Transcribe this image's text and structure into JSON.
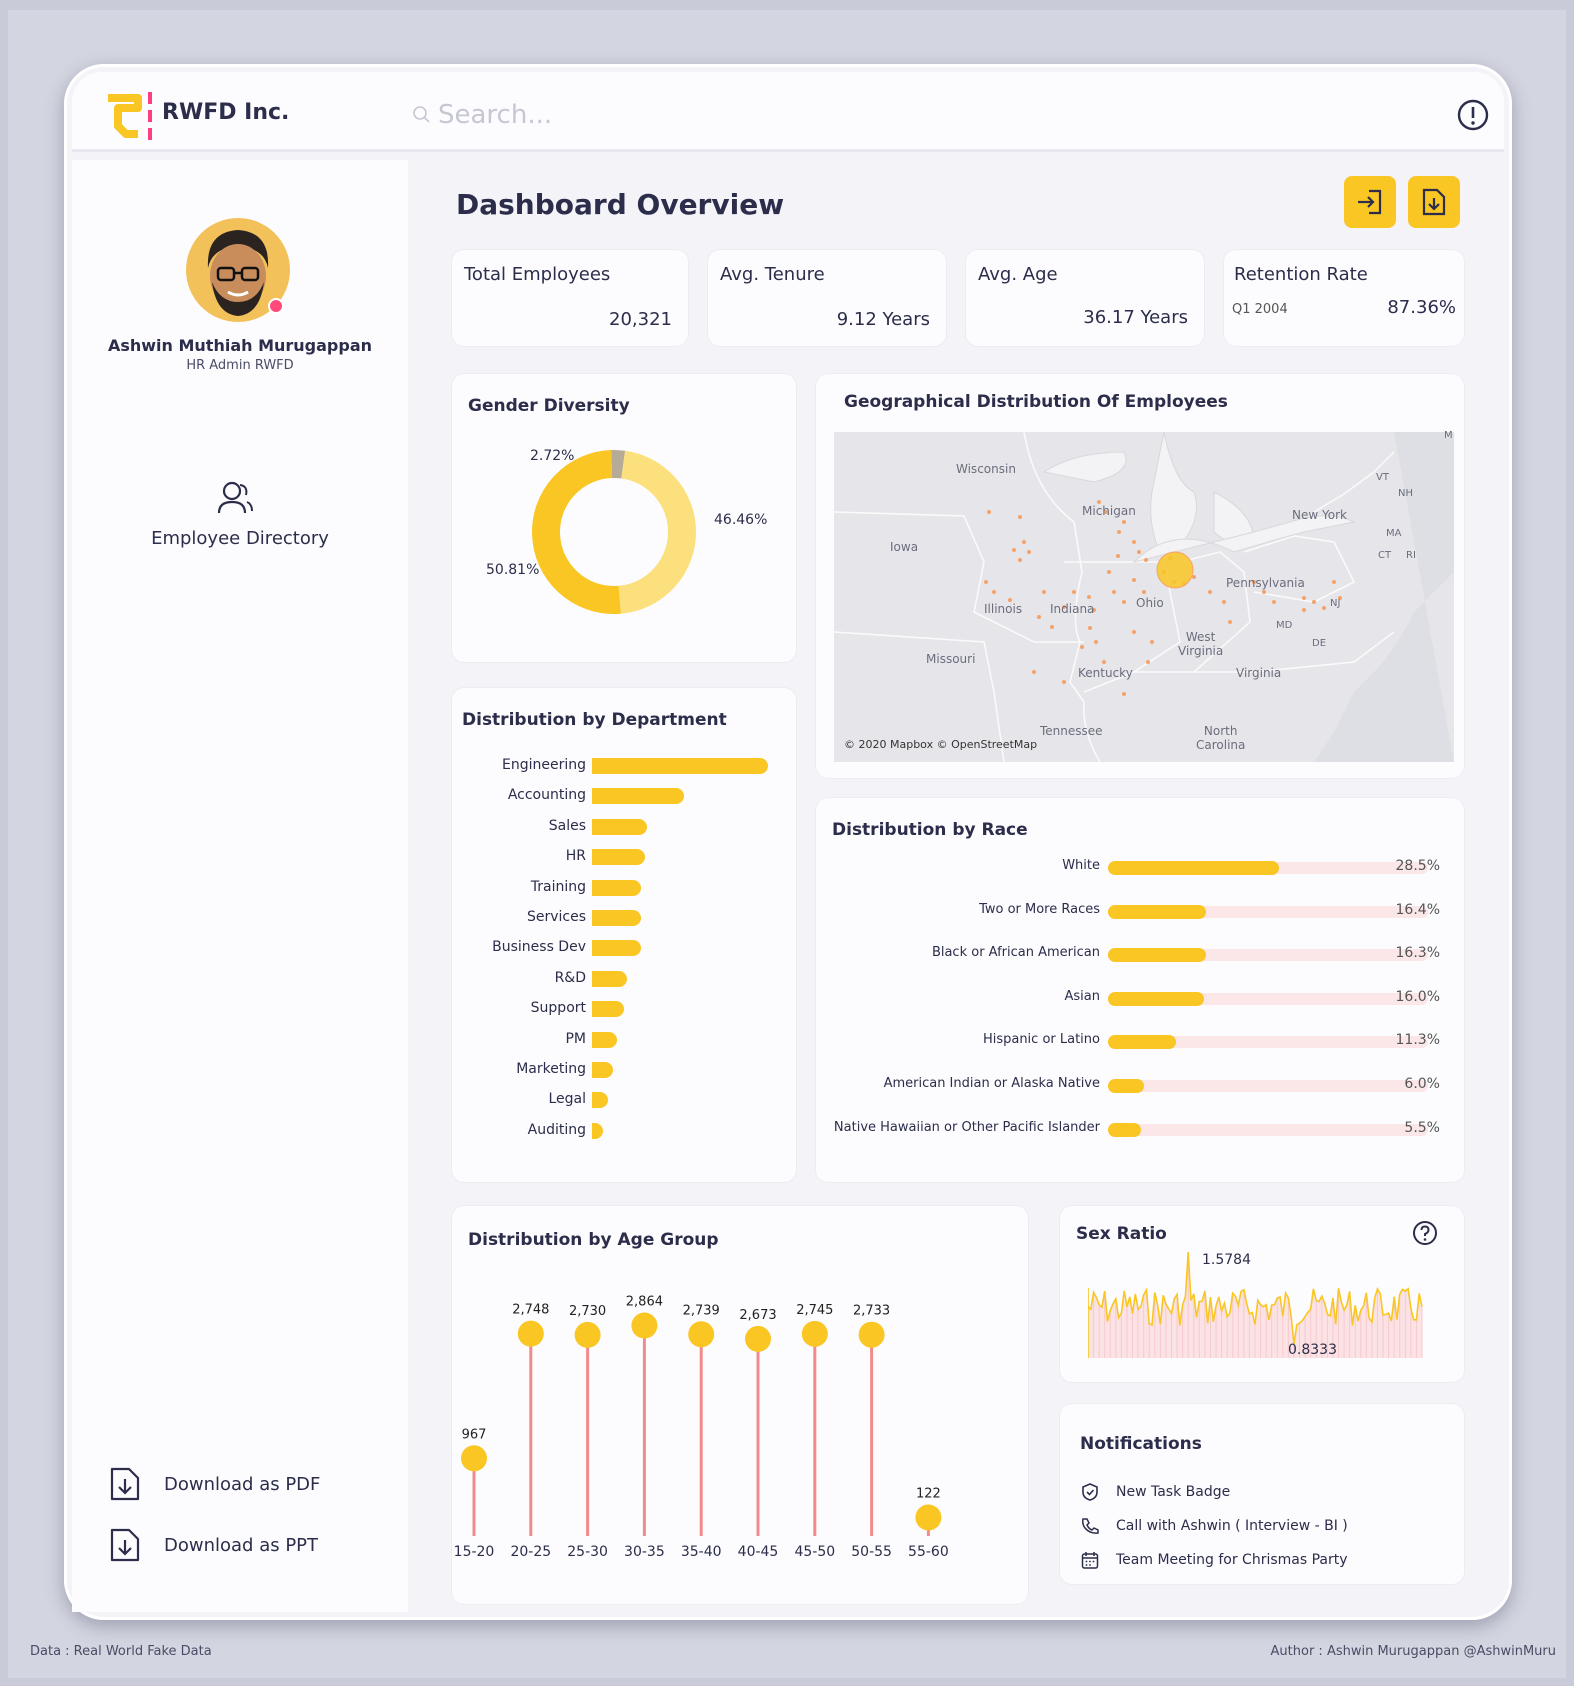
{
  "app": {
    "name": "RWFD Inc.",
    "search_placeholder": "Search..."
  },
  "user": {
    "name": "Ashwin Muthiah Murugappan",
    "role": "HR Admin RWFD"
  },
  "nav": {
    "directory": "Employee Directory",
    "download_pdf": "Download as PDF",
    "download_ppt": "Download as PPT"
  },
  "page_title": "Dashboard Overview",
  "kpis": {
    "total_employees": {
      "label": "Total Employees",
      "value": "20,321"
    },
    "avg_tenure": {
      "label": "Avg. Tenure",
      "value": "9.12 Years"
    },
    "avg_age": {
      "label": "Avg. Age",
      "value": "36.17 Years"
    },
    "retention": {
      "label": "Retention Rate",
      "period": "Q1 2004",
      "value": "87.36%"
    }
  },
  "colors": {
    "accent": "#f9c623",
    "accent_light": "#fde07e",
    "stem": "#f28c8c",
    "other": "#b5ab97"
  },
  "gender": {
    "title": "Gender Diversity",
    "labels": {
      "small": "2.72%",
      "right": "46.46%",
      "left": "50.81%"
    },
    "values": [
      50.81,
      46.46,
      2.72
    ]
  },
  "geo": {
    "title": "Geographical Distribution Of Employees",
    "attribution": "© 2020 Mapbox © OpenStreetMap",
    "places": {
      "wisconsin": "Wisconsin",
      "michigan": "Michigan",
      "iowa": "Iowa",
      "newyork": "New York",
      "vt": "VT",
      "nh": "NH",
      "ma": "MA",
      "ct": "CT",
      "ri": "RI",
      "pennsylvania": "Pennsylvania",
      "ohio": "Ohio",
      "illinois": "Illinois",
      "indiana": "Indiana",
      "md": "MD",
      "nj": "NJ",
      "de": "DE",
      "missouri": "Missouri",
      "westvirginia": "West\nVirginia",
      "kentucky": "Kentucky",
      "virginia": "Virginia",
      "tennessee": "Tennessee",
      "northcarolina": "North\nCarolina",
      "m": "M"
    }
  },
  "departments": {
    "title": "Distribution by Department",
    "items": [
      {
        "name": "Engineering",
        "value": 100
      },
      {
        "name": "Accounting",
        "value": 52
      },
      {
        "name": "Sales",
        "value": 31
      },
      {
        "name": "HR",
        "value": 30
      },
      {
        "name": "Training",
        "value": 28
      },
      {
        "name": "Services",
        "value": 28
      },
      {
        "name": "Business Dev",
        "value": 28
      },
      {
        "name": "R&D",
        "value": 20
      },
      {
        "name": "Support",
        "value": 18
      },
      {
        "name": "PM",
        "value": 14
      },
      {
        "name": "Marketing",
        "value": 12
      },
      {
        "name": "Legal",
        "value": 9
      },
      {
        "name": "Auditing",
        "value": 6
      }
    ]
  },
  "race": {
    "title": "Distribution by Race",
    "items": [
      {
        "name": "White",
        "value": 28.5,
        "label": "28.5%"
      },
      {
        "name": "Two or More Races",
        "value": 16.4,
        "label": "16.4%"
      },
      {
        "name": "Black or African American",
        "value": 16.3,
        "label": "16.3%"
      },
      {
        "name": "Asian",
        "value": 16.0,
        "label": "16.0%"
      },
      {
        "name": "Hispanic or Latino",
        "value": 11.3,
        "label": "11.3%"
      },
      {
        "name": "American Indian or Alaska Native",
        "value": 6.0,
        "label": "6.0%"
      },
      {
        "name": "Native Hawaiian or Other Pacific Islander",
        "value": 5.5,
        "label": "5.5%"
      }
    ]
  },
  "chart_data": {
    "type": "lollipop",
    "title": "Distribution by Age Group",
    "categories": [
      "15-20",
      "20-25",
      "25-30",
      "30-35",
      "35-40",
      "40-45",
      "45-50",
      "50-55",
      "55-60"
    ],
    "values": [
      967,
      2748,
      2730,
      2864,
      2739,
      2673,
      2745,
      2733,
      122
    ],
    "labels": [
      "967",
      "2,748",
      "2,730",
      "2,864",
      "2,739",
      "2,673",
      "2,745",
      "2,733",
      "122"
    ],
    "ylim": [
      0,
      3000
    ]
  },
  "sex_ratio": {
    "title": "Sex Ratio",
    "max_label": "1.5784",
    "min_label": "0.8333"
  },
  "notifications": {
    "title": "Notifications",
    "items": [
      "New Task Badge",
      "Call with Ashwin ( Interview - BI )",
      "Team Meeting for Chrismas Party"
    ]
  },
  "footer": {
    "data": "Data : Real World Fake Data",
    "author": "Author : Ashwin Murugappan @AshwinMuru"
  }
}
